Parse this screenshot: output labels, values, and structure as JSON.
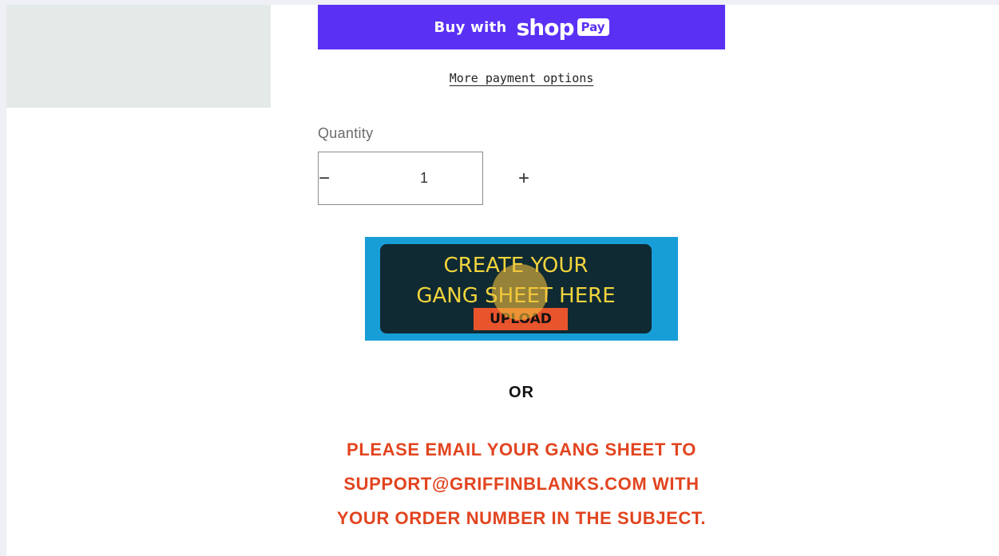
{
  "product": {
    "buy_button": {
      "prefix": "Buy with",
      "brand": "shop",
      "pay_badge": "Pay"
    },
    "more_payment_options": "More payment options",
    "quantity": {
      "label": "Quantity",
      "value": "1",
      "decrease_symbol": "−",
      "increase_symbol": "+"
    }
  },
  "gang_sheet_banner": {
    "line1": "CREATE YOUR",
    "line2": "GANG SHEET HERE",
    "button": "UPLOAD"
  },
  "divider_text": "OR",
  "notice": {
    "line1": "PLEASE EMAIL YOUR GANG SHEET TO",
    "line2": "SUPPORT@GRIFFINBLANKS.COM WITH",
    "line3": "YOUR ORDER NUMBER IN THE SUBJECT."
  },
  "colors": {
    "shop_pay": "#5a31f4",
    "banner_bg": "#189ed6",
    "banner_inner": "#0f2a33",
    "banner_text": "#f2d43d",
    "upload_button": "#e8542c",
    "notice_text": "#e2441f"
  }
}
